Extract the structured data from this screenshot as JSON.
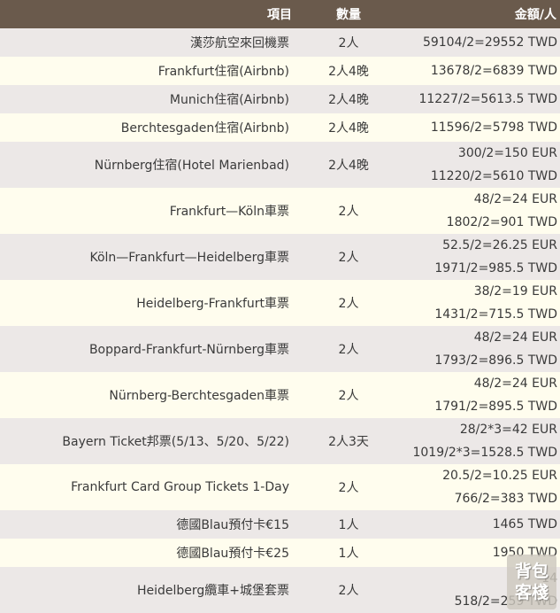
{
  "header": {
    "item": "項目",
    "qty": "數量",
    "amount": "金額/人"
  },
  "rows": [
    {
      "item": "漢莎航空來回機票",
      "qty": "2人",
      "amounts": [
        "59104/2=29552 TWD"
      ]
    },
    {
      "item": "Frankfurt住宿(Airbnb)",
      "qty": "2人4晚",
      "amounts": [
        "13678/2=6839 TWD"
      ]
    },
    {
      "item": "Munich住宿(Airbnb)",
      "qty": "2人4晚",
      "amounts": [
        "11227/2=5613.5 TWD"
      ]
    },
    {
      "item": "Berchtesgaden住宿(Airbnb)",
      "qty": "2人4晚",
      "amounts": [
        "11596/2=5798 TWD"
      ]
    },
    {
      "item": "Nürnberg住宿(Hotel Marienbad)",
      "qty": "2人4晚",
      "amounts": [
        "300/2=150 EUR",
        "11220/2=5610 TWD"
      ]
    },
    {
      "item": "Frankfurt—Köln車票",
      "qty": "2人",
      "amounts": [
        "48/2=24 EUR",
        "1802/2=901 TWD"
      ]
    },
    {
      "item": "Köln—Frankfurt—Heidelberg車票",
      "qty": "2人",
      "amounts": [
        "52.5/2=26.25 EUR",
        "1971/2=985.5 TWD"
      ]
    },
    {
      "item": "Heidelberg-Frankfurt車票",
      "qty": "2人",
      "amounts": [
        "38/2=19 EUR",
        "1431/2=715.5 TWD"
      ]
    },
    {
      "item": "Boppard-Frankfurt-Nürnberg車票",
      "qty": "2人",
      "amounts": [
        "48/2=24 EUR",
        "1793/2=896.5 TWD"
      ]
    },
    {
      "item": "Nürnberg-Berchtesgaden車票",
      "qty": "2人",
      "amounts": [
        "48/2=24 EUR",
        "1791/2=895.5 TWD"
      ]
    },
    {
      "item": "Bayern Ticket邦票(5/13、5/20、5/22)",
      "qty": "2人3天",
      "amounts": [
        "28/2*3=42 EUR",
        "1019/2*3=1528.5 TWD"
      ]
    },
    {
      "item": "Frankfurt Card Group Tickets 1-Day",
      "qty": "2人",
      "amounts": [
        "20.5/2=10.25 EUR",
        "766/2=383 TWD"
      ]
    },
    {
      "item": "德國Blau預付卡€15",
      "qty": "1人",
      "amounts": [
        "1465 TWD"
      ]
    },
    {
      "item": "德國Blau預付卡€25",
      "qty": "1人",
      "amounts": [
        "1950 TWD"
      ]
    },
    {
      "item": "Heidelberg纜車+城堡套票",
      "qty": "2人",
      "amounts": [
        "14",
        "518/2=259 TWD"
      ]
    }
  ],
  "watermark": {
    "line1": "背包",
    "line2": "客棧"
  }
}
